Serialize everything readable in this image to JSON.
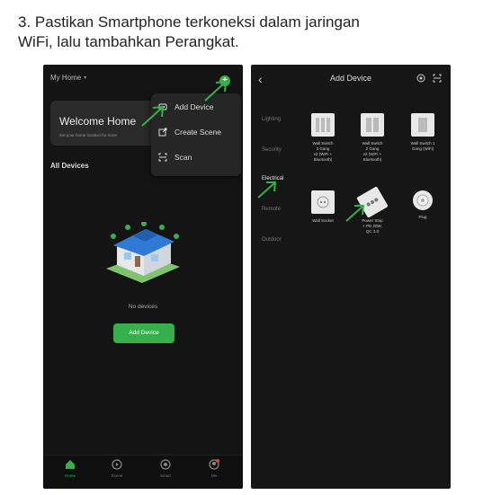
{
  "instruction": {
    "line1": "3. Pastikan Smartphone terkoneksi dalam jaringan",
    "line2": "WiFi, lalu tambahkan Perangkat."
  },
  "phone1": {
    "home_dropdown": "My Home ",
    "add_icon": "plus-icon",
    "welcome_title": "Welcome Home",
    "welcome_subtitle": "Set your home location for more",
    "all_devices": "All Devices",
    "menu": {
      "items": [
        {
          "label": "Add Device",
          "icon": "add-device-icon"
        },
        {
          "label": "Create Scene",
          "icon": "create-scene-icon"
        },
        {
          "label": "Scan",
          "icon": "scan-icon"
        }
      ]
    },
    "no_devices": "No devices",
    "add_device_button": "Add Device",
    "tabbar": [
      {
        "label": "Home",
        "icon": "home-icon",
        "active": true
      },
      {
        "label": "Scene",
        "icon": "scene-icon",
        "active": false
      },
      {
        "label": "Smart",
        "icon": "smart-icon",
        "active": false
      },
      {
        "label": "Me",
        "icon": "profile-icon",
        "active": false
      }
    ]
  },
  "phone2": {
    "title": "Add Device",
    "back_icon": "back-icon",
    "top_icons": [
      "target-icon",
      "scan-icon"
    ],
    "categories": [
      {
        "label": "Lighting",
        "active": false
      },
      {
        "label": "Security",
        "active": false
      },
      {
        "label": "Electrical",
        "active": true
      },
      {
        "label": "Remote",
        "active": false
      },
      {
        "label": "Outdoor",
        "active": false
      }
    ],
    "devices": [
      {
        "name": "Wall Switch\n3 Gang\nv2 (WiFi +\nBluetooth)",
        "icon": "wall-switch-3-icon"
      },
      {
        "name": "Wall Switch\n2 Gang\nv2 (WiFi +\nBluetooth)",
        "icon": "wall-switch-2-icon"
      },
      {
        "name": "Wall Switch 1\nGang (WiFi)",
        "icon": "wall-switch-1-icon"
      },
      {
        "name": "Wall Socket",
        "icon": "wall-socket-icon"
      },
      {
        "name": "Power Strip\n+ PD 20W,\nQC 3.0",
        "icon": "power-strip-icon"
      },
      {
        "name": "Plug",
        "icon": "plug-icon"
      }
    ]
  },
  "colors": {
    "accent": "#35b04b",
    "phone_bg": "#141414"
  }
}
